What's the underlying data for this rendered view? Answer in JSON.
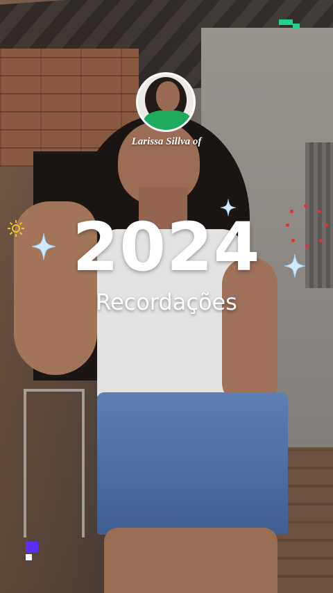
{
  "profile": {
    "name": "Larissa Sillva of"
  },
  "title": {
    "year": "2024",
    "subtitle": "Recordações"
  },
  "colors": {
    "accent_green": "#1ed38a",
    "accent_purple": "#5b2dff",
    "sparkle_blue": "#9fd4ff",
    "dot_red": "#e0342a",
    "sunburst_yellow": "#f2c230"
  }
}
